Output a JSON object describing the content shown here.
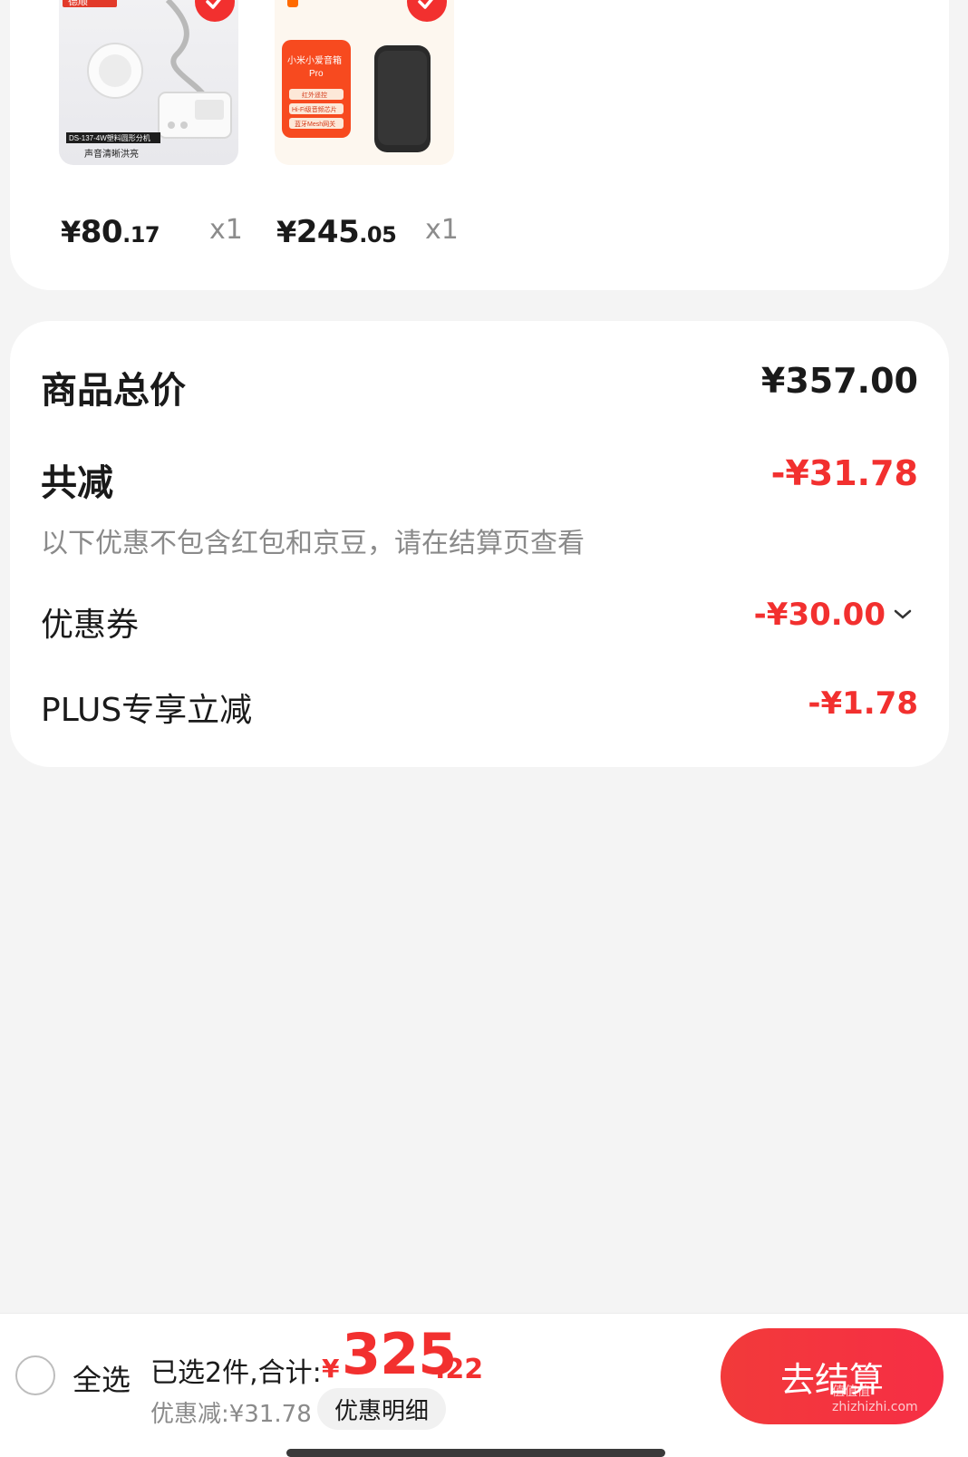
{
  "products": [
    {
      "price_symbol": "¥",
      "price_int": "80",
      "price_dec": ".17",
      "qty": "x1",
      "image_texts": {
        "brand": "德顺",
        "model_line": "DS-137-4W塑料圆形分机",
        "caption": "声音清晰洪亮"
      }
    },
    {
      "price_symbol": "¥",
      "price_int": "245",
      "price_dec": ".05",
      "qty": "x1",
      "image_texts": {
        "title": "小米小爱音箱",
        "title2": "Pro",
        "f1": "红外遥控",
        "f2": "Hi-Fi级音频芯片",
        "f3": "蓝牙Mesh网关"
      }
    }
  ],
  "summary": {
    "total_label": "商品总价",
    "total_value": "¥357.00",
    "discount_label": "共减",
    "discount_value": "-¥31.78",
    "note": "以下优惠不包含红包和京豆，请在结算页查看",
    "coupon_label": "优惠券",
    "coupon_value": "-¥30.00",
    "plus_label": "PLUS专享立减",
    "plus_value": "-¥1.78"
  },
  "bottom_bar": {
    "select_all": "全选",
    "selected_text": "已选2件,合计:",
    "currency": "¥",
    "total_int": "325",
    "total_dec": ".22",
    "saved_text": "优惠减:¥31.78",
    "detail_button": "优惠明细",
    "checkout_button": "去结算"
  },
  "watermark": "值值值 zhizhizhi.com",
  "colors": {
    "accent": "#f2302f",
    "background": "#f4f4f4",
    "card": "#ffffff"
  },
  "icons": [
    "check-icon",
    "chevron-down-icon",
    "radio-icon"
  ]
}
